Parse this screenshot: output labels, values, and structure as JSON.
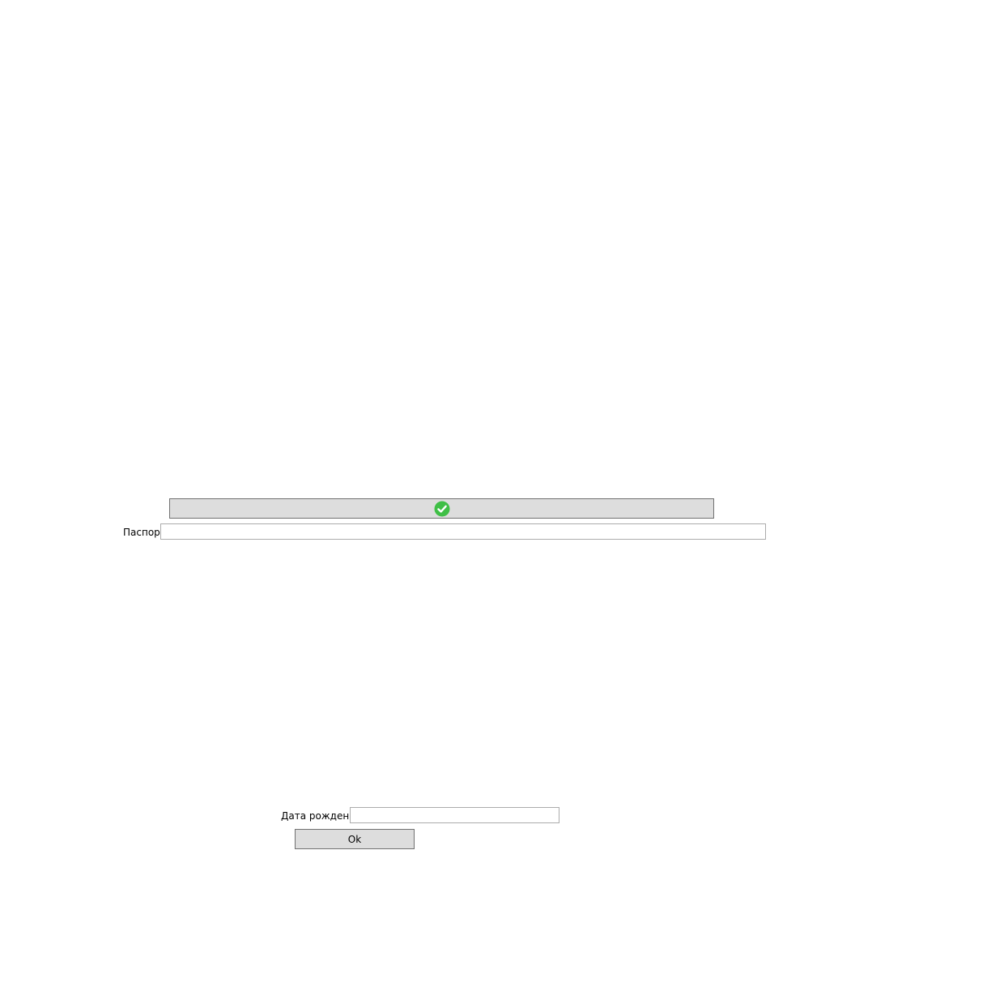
{
  "confirm_button": {
    "icon": "check-circle-icon",
    "icon_color": "#3fbf46"
  },
  "passport": {
    "label": "Паспорт",
    "value": "",
    "placeholder": ""
  },
  "birth_date": {
    "label": "Дата рождения",
    "value": "",
    "placeholder": ""
  },
  "ok_button": {
    "label": "Ok"
  },
  "colors": {
    "button_background": "#dddddd",
    "button_border": "#707070",
    "field_border": "#ababab"
  }
}
